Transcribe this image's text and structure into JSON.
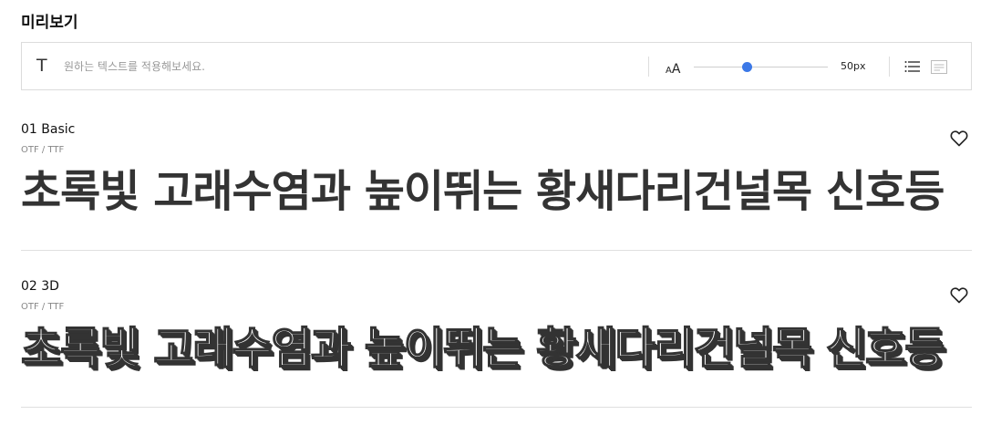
{
  "page": {
    "title": "미리보기"
  },
  "toolbar": {
    "placeholder": "원하는 텍스트를 적용해보세요.",
    "size_small": "A",
    "size_big": "A",
    "size_value": "50px",
    "slider_fraction": 0.4,
    "accent_color": "#3b78e7",
    "text_icon": "T"
  },
  "fonts": [
    {
      "name": "01 Basic",
      "formats": "OTF / TTF",
      "preview": "초록빛 고래수염과 높이뛰는 황새다리건널목 신호등"
    },
    {
      "name": "02 3D",
      "formats": "OTF / TTF",
      "preview": "초록빛 고래수염과 높이뛰는 황새다리건널목 신호등"
    }
  ]
}
